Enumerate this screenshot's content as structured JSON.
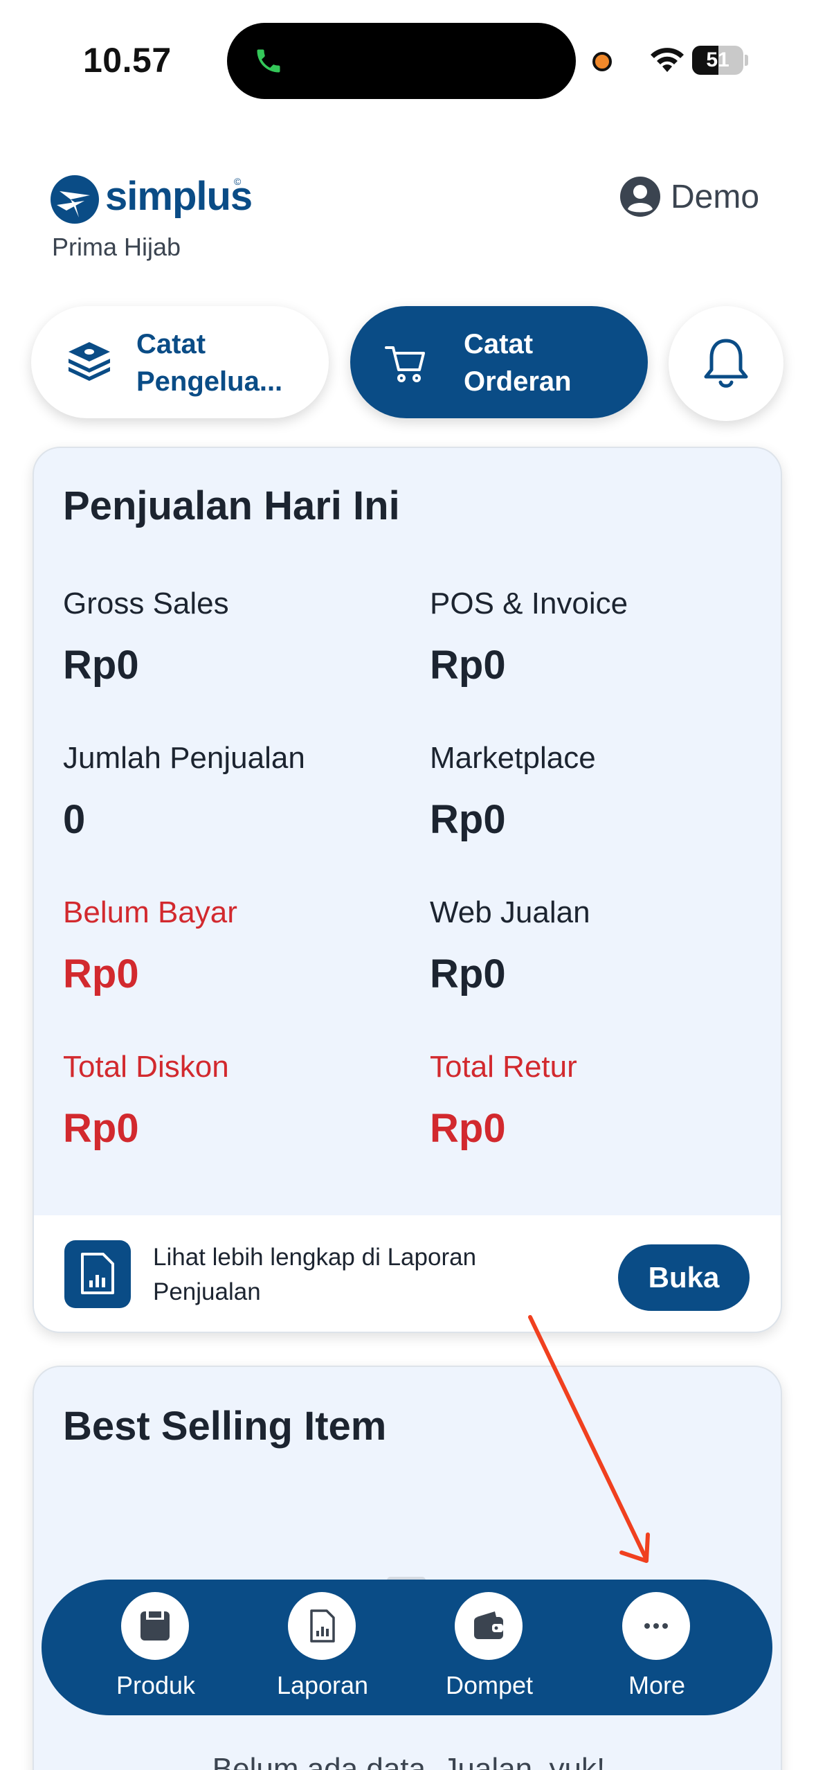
{
  "status_bar": {
    "time": "10.57",
    "battery_level": "51",
    "battery_fraction": 0.51,
    "call_icon": "phone-icon",
    "wifi_icon": "wifi-icon",
    "recording_dot_color": "#f0882a"
  },
  "header": {
    "logo_text": "simplus",
    "store_name": "Prima Hijab",
    "user_name": "Demo",
    "user_icon": "user-avatar-icon"
  },
  "actions": {
    "expense_label": "Catat\nPengelua...",
    "order_label": "Catat\nOrderan",
    "notification_icon": "bell-icon"
  },
  "sales": {
    "title": "Penjualan Hari Ini",
    "metrics": [
      {
        "label": "Gross Sales",
        "value": "Rp0"
      },
      {
        "label": "POS & Invoice",
        "value": "Rp0"
      },
      {
        "label": "Jumlah Penjualan",
        "value": "0"
      },
      {
        "label": "Marketplace",
        "value": "Rp0"
      },
      {
        "label": "Belum Bayar",
        "value": "Rp0"
      },
      {
        "label": "Web Jualan",
        "value": "Rp0"
      },
      {
        "label": "Total Diskon",
        "value": "Rp0"
      },
      {
        "label": "Total Retur",
        "value": "Rp0"
      }
    ],
    "footer_text": "Lihat lebih lengkap di Laporan Penjualan",
    "open_button": "Buka"
  },
  "best_selling": {
    "title": "Best Selling Item",
    "empty_text": "Belum ada data. Jualan, yuk!"
  },
  "bottom_nav": {
    "items": [
      {
        "label": "Produk",
        "icon": "box-icon"
      },
      {
        "label": "Laporan",
        "icon": "report-icon"
      },
      {
        "label": "Dompet",
        "icon": "wallet-icon"
      },
      {
        "label": "More",
        "icon": "more-icon"
      }
    ]
  },
  "colors": {
    "primary": "#0a4c86",
    "alert_red": "#d2292e",
    "card_bg": "#eef4fd",
    "annotation_arrow": "#f0401f"
  }
}
